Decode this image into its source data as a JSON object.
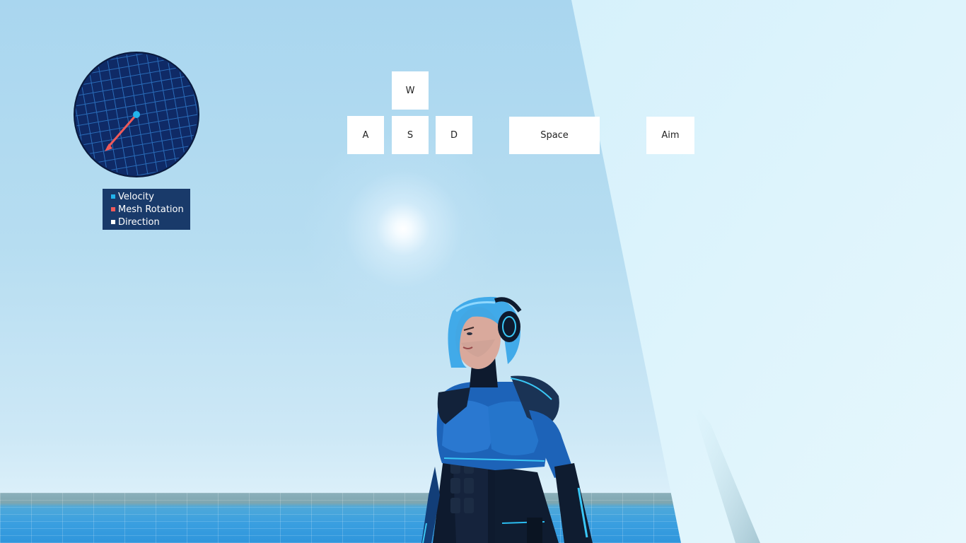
{
  "keys": {
    "w": "W",
    "a": "A",
    "s": "S",
    "d": "D",
    "space": "Space",
    "aim": "Aim"
  },
  "legend": [
    {
      "label": "Velocity",
      "color": "#22b3ec"
    },
    {
      "label": "Mesh Rotation",
      "color": "#ef5a5a"
    },
    {
      "label": "Direction",
      "color": "#ffffff"
    }
  ],
  "compass": {
    "background": "#0f2a66",
    "grid_color": "#2f78c8",
    "velocity_color": "#22b3ec",
    "rotation_color": "#ef5a5a"
  }
}
